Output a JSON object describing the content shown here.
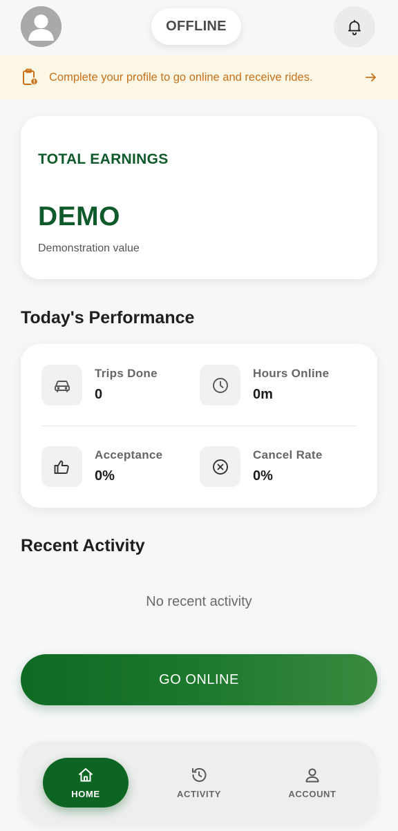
{
  "header": {
    "status_label": "OFFLINE"
  },
  "banner": {
    "text": "Complete your profile to go online and receive rides."
  },
  "earnings": {
    "title": "TOTAL EARNINGS",
    "value": "DEMO",
    "subtitle": "Demonstration value"
  },
  "performance": {
    "title": "Today's Performance",
    "stats": [
      {
        "label": "Trips Done",
        "value": "0",
        "icon": "car-icon"
      },
      {
        "label": "Hours Online",
        "value": "0m",
        "icon": "clock-icon"
      },
      {
        "label": "Acceptance",
        "value": "0%",
        "icon": "thumbs-up-icon"
      },
      {
        "label": "Cancel Rate",
        "value": "0%",
        "icon": "cancel-circle-icon"
      }
    ]
  },
  "activity": {
    "title": "Recent Activity",
    "empty_text": "No recent activity"
  },
  "go_online_label": "GO ONLINE",
  "nav": {
    "items": [
      {
        "label": "HOME",
        "icon": "home-icon",
        "active": true
      },
      {
        "label": "ACTIVITY",
        "icon": "history-icon",
        "active": false
      },
      {
        "label": "ACCOUNT",
        "icon": "user-icon",
        "active": false
      }
    ]
  },
  "colors": {
    "brand_green": "#0e5a2b",
    "button_green": "#0f6a22",
    "banner_text": "#c9701a",
    "banner_bg": "#fdf8e6"
  }
}
